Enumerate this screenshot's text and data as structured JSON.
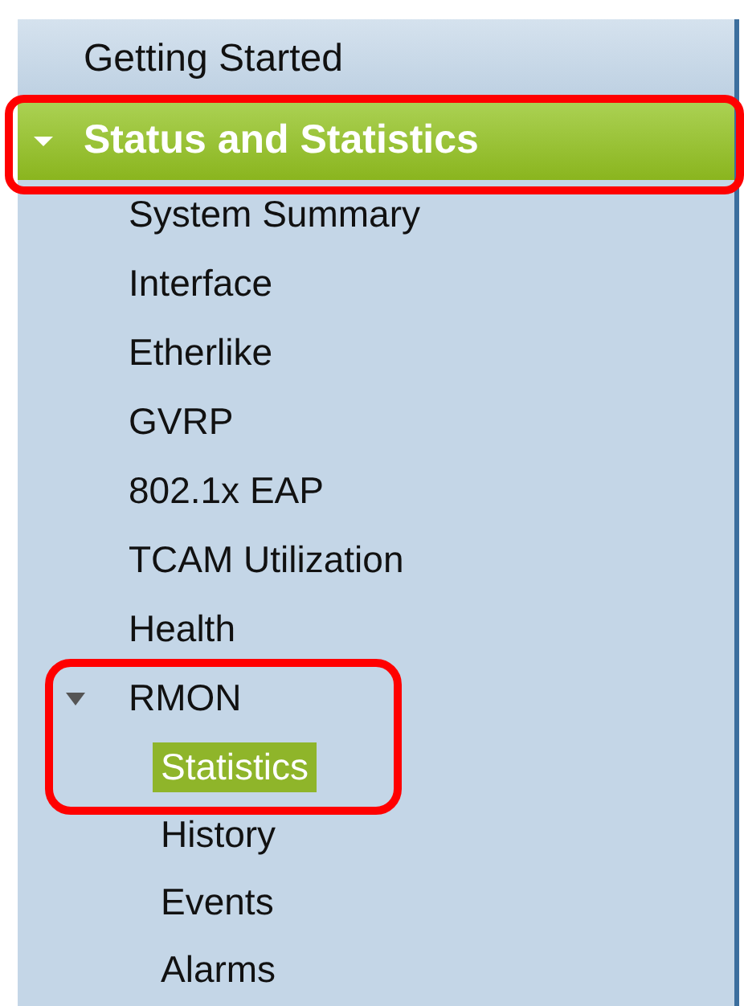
{
  "menu": [
    {
      "kind": "link",
      "label": "Getting Started"
    },
    {
      "kind": "section",
      "label": "Status and Statistics",
      "expanded": true,
      "selected": true,
      "highlighted": true,
      "children": [
        {
          "kind": "item",
          "label": "System Summary"
        },
        {
          "kind": "item",
          "label": "Interface"
        },
        {
          "kind": "item",
          "label": "Etherlike"
        },
        {
          "kind": "item",
          "label": "GVRP"
        },
        {
          "kind": "item",
          "label": "802.1x EAP"
        },
        {
          "kind": "item",
          "label": "TCAM Utilization"
        },
        {
          "kind": "item",
          "label": "Health"
        },
        {
          "kind": "group",
          "label": "RMON",
          "expanded": true,
          "highlighted": true,
          "children": [
            {
              "kind": "item",
              "label": "Statistics",
              "selected": true
            },
            {
              "kind": "item",
              "label": "History",
              "selected": false
            },
            {
              "kind": "item",
              "label": "Events",
              "selected": false
            },
            {
              "kind": "item",
              "label": "Alarms",
              "selected": false
            }
          ]
        }
      ]
    }
  ]
}
